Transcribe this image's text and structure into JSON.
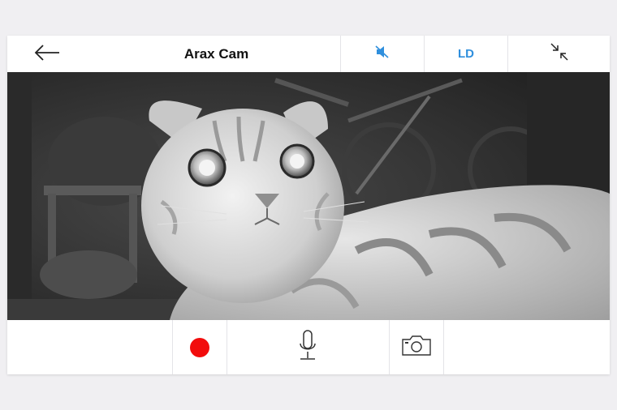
{
  "app": {
    "title": "Arax Cam"
  },
  "toolbar": {
    "back_icon": "arrow-left-icon",
    "mute_icon": "speaker-muted-icon",
    "quality_label": "LD",
    "collapse_icon": "collapse-arrows-icon"
  },
  "video": {
    "description_icon": "live-camera-feed"
  },
  "controls": {
    "record_icon": "record-dot-icon",
    "mic_icon": "microphone-icon",
    "snapshot_icon": "camera-icon"
  },
  "colors": {
    "accent": "#2f8fdd",
    "record": "#f20c0c",
    "background": "#f0eff2"
  }
}
